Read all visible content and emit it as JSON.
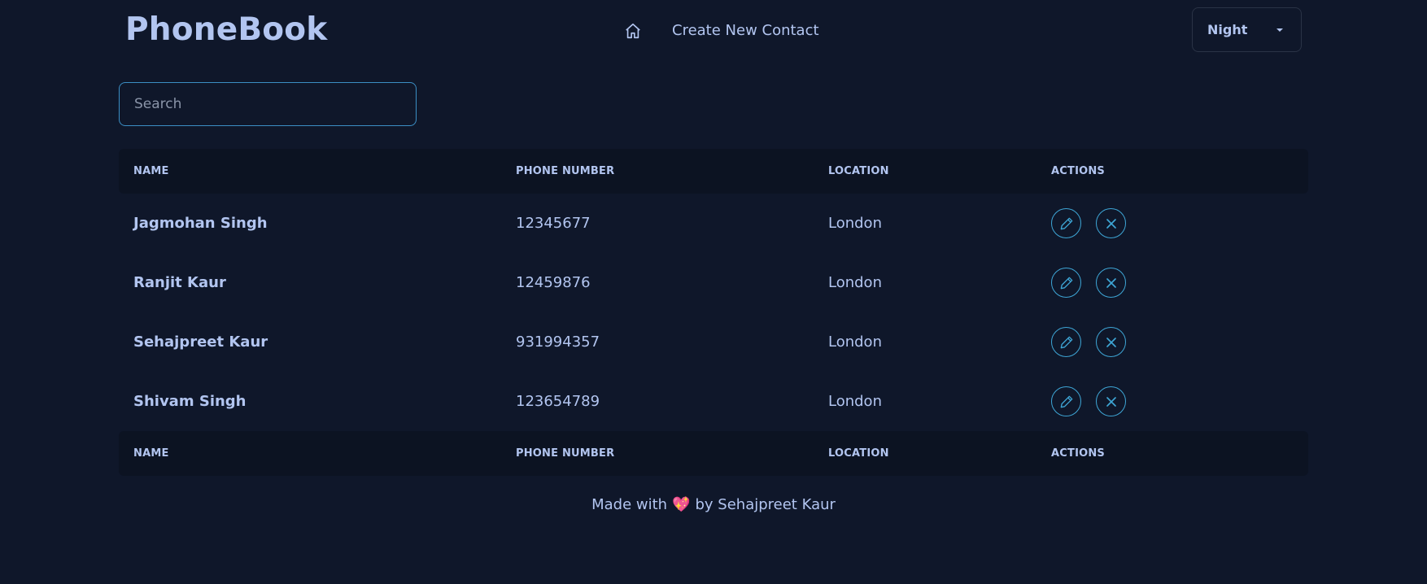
{
  "header": {
    "brand": "PhoneBook",
    "nav_create": "Create New Contact",
    "theme": "Night"
  },
  "search": {
    "placeholder": "Search"
  },
  "table": {
    "columns": [
      "NAME",
      "PHONE NUMBER",
      "LOCATION",
      "ACTIONS"
    ],
    "rows": [
      {
        "name": "Jagmohan Singh",
        "phone": "12345677",
        "location": "London"
      },
      {
        "name": "Ranjit Kaur",
        "phone": "12459876",
        "location": "London"
      },
      {
        "name": "Sehajpreet Kaur",
        "phone": "931994357",
        "location": "London"
      },
      {
        "name": "Shivam Singh",
        "phone": "123654789",
        "location": "London"
      }
    ]
  },
  "footer": {
    "prefix": "Made with",
    "heart": "💖",
    "suffix": "by Sehajpreet Kaur"
  },
  "colors": {
    "background": "#0f172a",
    "accent": "#3ea6d6",
    "text": "#b2c5f0"
  }
}
